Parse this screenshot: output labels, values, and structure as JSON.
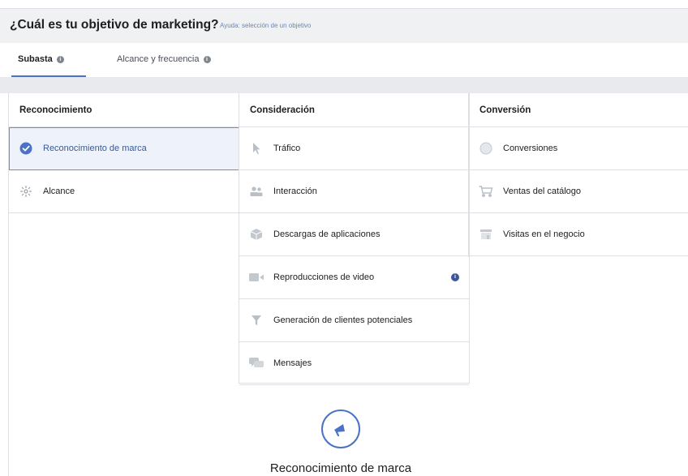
{
  "header": {
    "question": "¿Cuál es tu objetivo de marketing?",
    "help_link": "Ayuda: selección de un objetivo"
  },
  "tabs": [
    {
      "label": "Subasta",
      "active": true
    },
    {
      "label": "Alcance y frecuencia",
      "active": false
    }
  ],
  "columns": [
    {
      "title": "Reconocimiento",
      "items": [
        {
          "label": "Reconocimiento de marca",
          "icon": "check-circle-icon",
          "selected": true
        },
        {
          "label": "Alcance",
          "icon": "reach-icon"
        }
      ]
    },
    {
      "title": "Consideración",
      "items": [
        {
          "label": "Tráfico",
          "icon": "cursor-icon"
        },
        {
          "label": "Interacción",
          "icon": "people-icon"
        },
        {
          "label": "Descargas de aplicaciones",
          "icon": "app-box-icon"
        },
        {
          "label": "Reproducciones de video",
          "icon": "video-icon",
          "badge": "i"
        },
        {
          "label": "Generación de clientes potenciales",
          "icon": "funnel-icon"
        },
        {
          "label": "Mensajes",
          "icon": "chat-icon"
        }
      ]
    },
    {
      "title": "Conversión",
      "items": [
        {
          "label": "Conversiones",
          "icon": "globe-icon"
        },
        {
          "label": "Ventas del catálogo",
          "icon": "cart-icon"
        },
        {
          "label": "Visitas en el negocio",
          "icon": "store-icon"
        }
      ]
    }
  ],
  "summary": {
    "title": "Reconocimiento de marca",
    "icon": "megaphone-icon"
  },
  "colors": {
    "accent": "#4a72c6",
    "selected_bg": "#eef3fb",
    "header_bg": "#f0f1f3"
  }
}
